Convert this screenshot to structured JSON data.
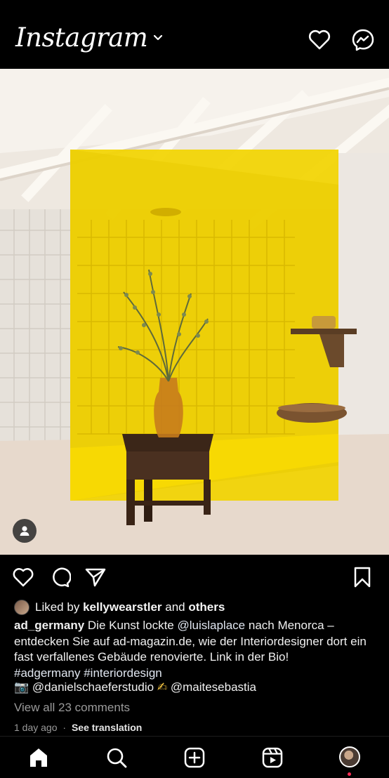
{
  "app": {
    "title": "Instagram"
  },
  "post": {
    "liked_prefix": "Liked by",
    "liked_user": "kellywearstler",
    "liked_and": "and",
    "liked_others": "others",
    "author": "ad_germany",
    "caption_1": "Die Kunst lockte",
    "caption_mention": "@luislaplace",
    "caption_2": "nach Menorca – entdecken Sie auf ad-magazin.de, wie der Interiordesigner dort ein fast verfallenes Gebäude renovierte. Link in der Bio!",
    "hashtags": "#adgermany #interiordesign",
    "credit_photo_emoji": "📷",
    "credit_photographer": "@danielschaeferstudio",
    "credit_write_emoji": "✍",
    "credit_stylist": "@maitesebastia",
    "view_comments": "View all 23 comments",
    "time_ago": "1 day ago",
    "separator": "·",
    "see_translation": "See translation"
  },
  "icons": {
    "header": [
      "heart-icon",
      "messenger-icon"
    ],
    "actions": [
      "like-icon",
      "comment-icon",
      "share-icon",
      "save-icon"
    ],
    "nav": [
      "home-icon",
      "search-icon",
      "create-icon",
      "reels-icon",
      "profile-avatar"
    ]
  },
  "colors": {
    "background": "#000000",
    "text": "#f5f5f5",
    "muted": "#9a9a9a",
    "notification": "#ff2d55",
    "shower_glass": "#f5d800"
  }
}
